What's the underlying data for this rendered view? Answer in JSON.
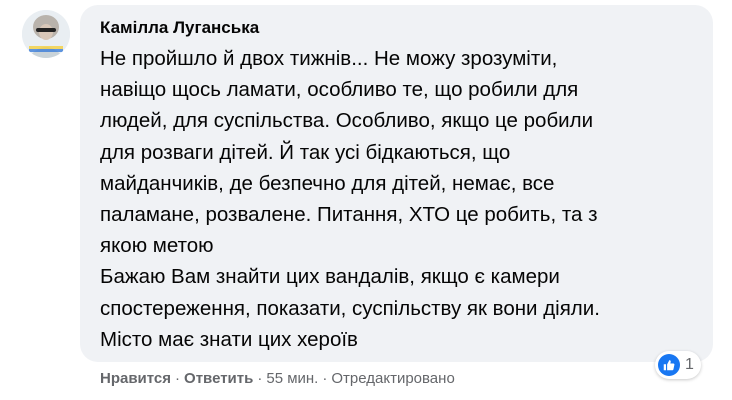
{
  "comment": {
    "author": "Камілла Луганська",
    "lines": [
      "Не пройшло й двох тижнів... Не можу зрозуміти,",
      "навіщо щось ламати, особливо те, що робили для",
      "людей, для суспільства. Особливо, якщо це робили",
      "для розваги дітей. Й так усі бідкаються, що",
      "майданчиків, де безпечно для дітей, немає, все",
      "паламане, розвалене. Питання, ХТО це робить, та з",
      "якою метою",
      "Бажаю Вам знайти цих вандалів, якщо є камери",
      "спостереження, показати, суспільству як вони діяли.",
      "Місто має знати цих хероїв"
    ]
  },
  "reactions": {
    "icon": "like-icon",
    "count": "1",
    "color": "#1877f2"
  },
  "actions": {
    "like": "Нравится",
    "reply": "Ответить",
    "separator": "·",
    "time": "55 мин.",
    "edited": "Отредактировано"
  },
  "colors": {
    "bubble": "#f0f2f5",
    "text": "#050505",
    "meta": "#65676b"
  }
}
